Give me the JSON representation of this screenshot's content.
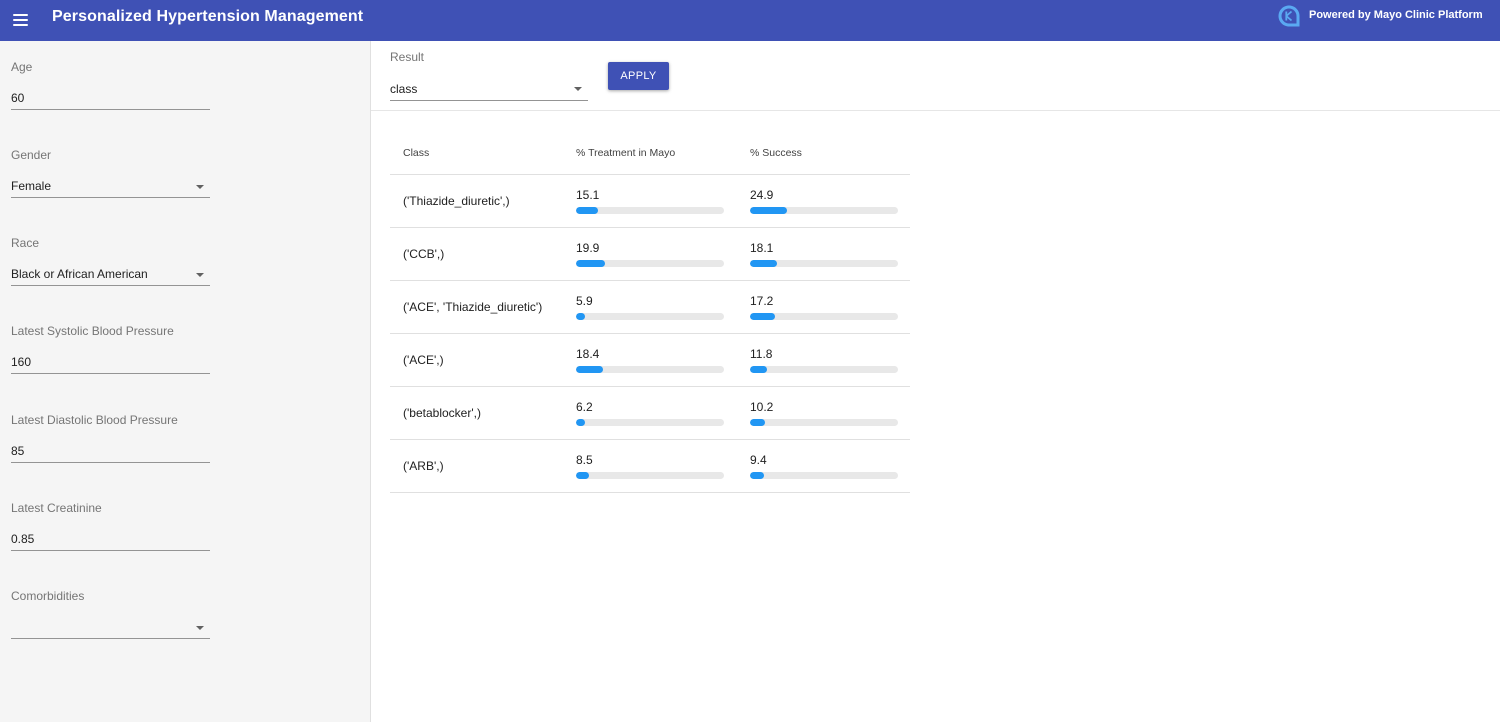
{
  "header": {
    "title": "Personalized Hypertension Management",
    "brand": "Powered by Mayo Clinic Platform",
    "color": "#3f51b5"
  },
  "sidebar": {
    "fields": [
      {
        "label": "Age",
        "value": "60",
        "type": "text"
      },
      {
        "label": "Gender",
        "value": "Female",
        "type": "select"
      },
      {
        "label": "Race",
        "value": "Black or African American",
        "type": "select"
      },
      {
        "label": "Latest Systolic Blood Pressure",
        "value": "160",
        "type": "text"
      },
      {
        "label": "Latest Diastolic Blood Pressure",
        "value": "85",
        "type": "text"
      },
      {
        "label": "Latest Creatinine",
        "value": "0.85",
        "type": "text"
      },
      {
        "label": "Comorbidities",
        "value": "",
        "type": "select"
      }
    ]
  },
  "toolbar": {
    "result_label": "Result",
    "result_value": "class",
    "apply_label": "APPLY"
  },
  "table": {
    "headers": [
      "Class",
      "% Treatment in Mayo",
      "% Success"
    ],
    "scale_max": 100,
    "rows": [
      {
        "class": "('Thiazide_diuretic',)",
        "treatment": 15.1,
        "success": 24.9
      },
      {
        "class": "('CCB',)",
        "treatment": 19.9,
        "success": 18.1
      },
      {
        "class": "('ACE', 'Thiazide_diuretic')",
        "treatment": 5.9,
        "success": 17.2
      },
      {
        "class": "('ACE',)",
        "treatment": 18.4,
        "success": 11.8
      },
      {
        "class": "('betablocker',)",
        "treatment": 6.2,
        "success": 10.2
      },
      {
        "class": "('ARB',)",
        "treatment": 8.5,
        "success": 9.4
      }
    ]
  }
}
